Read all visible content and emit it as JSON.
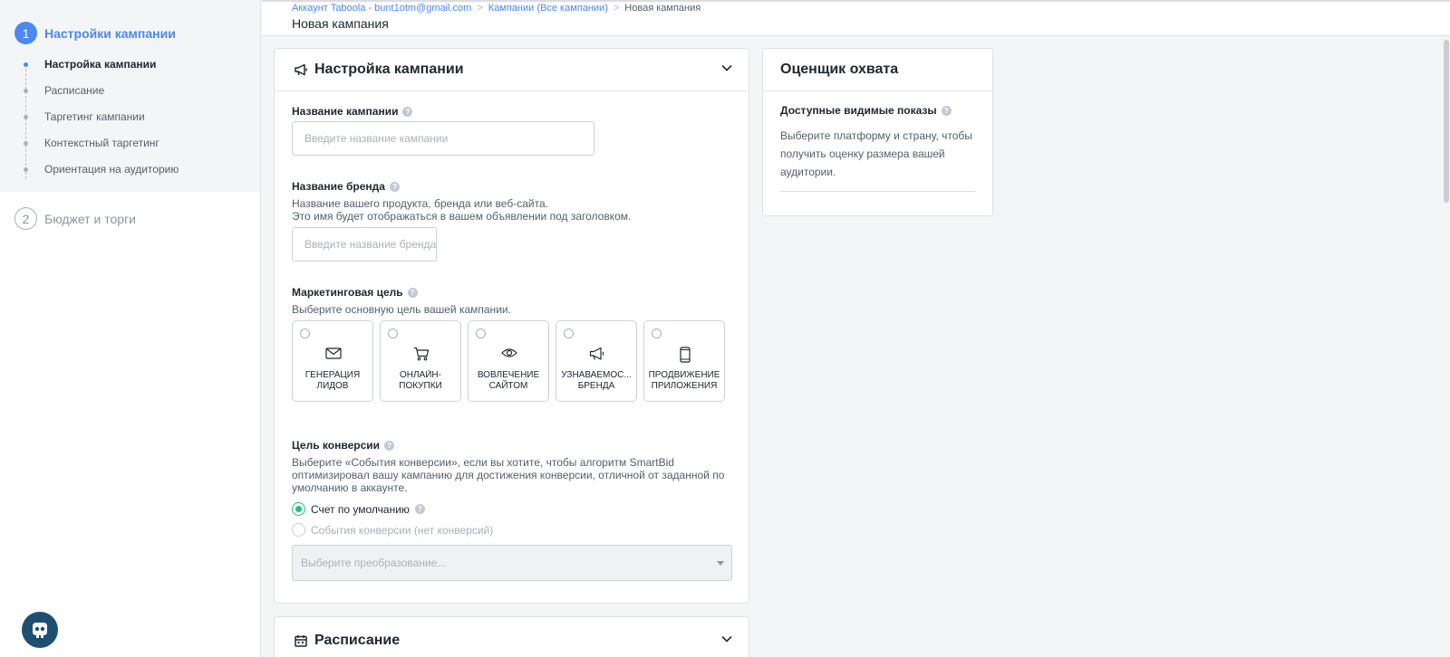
{
  "sidebar": {
    "step1": {
      "number": "1",
      "title": "Настройки кампании"
    },
    "sub_items": [
      {
        "label": "Настройка кампании",
        "active": true
      },
      {
        "label": "Расписание",
        "active": false
      },
      {
        "label": "Таргетинг кампании",
        "active": false
      },
      {
        "label": "Контекстный таргетинг",
        "active": false
      },
      {
        "label": "Ориентация на аудиторию",
        "active": false
      }
    ],
    "step2": {
      "number": "2",
      "title": "Бюджет и торги"
    }
  },
  "breadcrumb": {
    "account": "Аккаунт Taboola - bunt1otm@gmail.com",
    "campaigns": "Кампании (Все кампании)",
    "current": "Новая кампания",
    "separator": ">"
  },
  "page_title": "Новая кампания",
  "setup_card": {
    "title": "Настройка кампании",
    "icon": "megaphone-icon",
    "campaign_name": {
      "label": "Название кампании",
      "placeholder": "Введите название кампании",
      "value": ""
    },
    "brand_name": {
      "label": "Название бренда",
      "desc1": "Название вашего продукта, бренда или веб-сайта.",
      "desc2": "Это имя будет отображаться в вашем объявлении под заголовком.",
      "placeholder": "Введите название бренда",
      "value": ""
    },
    "marketing_goal": {
      "label": "Маркетинговая цель",
      "desc": "Выберите основную цель вашей кампании.",
      "options": [
        {
          "label": "Генерация лидов",
          "icon": "envelope-icon"
        },
        {
          "label": "Онлайн-покупки",
          "icon": "cart-icon"
        },
        {
          "label": "Вовлечение сайтом",
          "icon": "eye-icon"
        },
        {
          "label": "Узнаваемос... бренда",
          "icon": "megaphone-icon"
        },
        {
          "label": "Продвижение приложения",
          "icon": "phone-icon"
        }
      ]
    },
    "conversion_goal": {
      "label": "Цель конверсии",
      "desc": "Выберите «События конверсии», если вы хотите, чтобы алгоритм SmartBid оптимизировал вашу кампанию для достижения конверсии, отличной от заданной по умолчанию в аккаунте.",
      "option_default": "Счет по умолчанию",
      "option_events": "События конверсии (нет конверсий)",
      "select_placeholder": "Выберите преобразование..."
    }
  },
  "schedule_card": {
    "title": "Расписание",
    "icon": "calendar-icon"
  },
  "reach_card": {
    "title": "Оценщик охвата",
    "label": "Доступные видимые показы",
    "desc": "Выберите платформу и страну, чтобы получить оценку размера вашей аудитории."
  },
  "colors": {
    "accent": "#4b89f0",
    "radio_selected": "#1ec27e",
    "chat_button": "#1e4f73"
  }
}
